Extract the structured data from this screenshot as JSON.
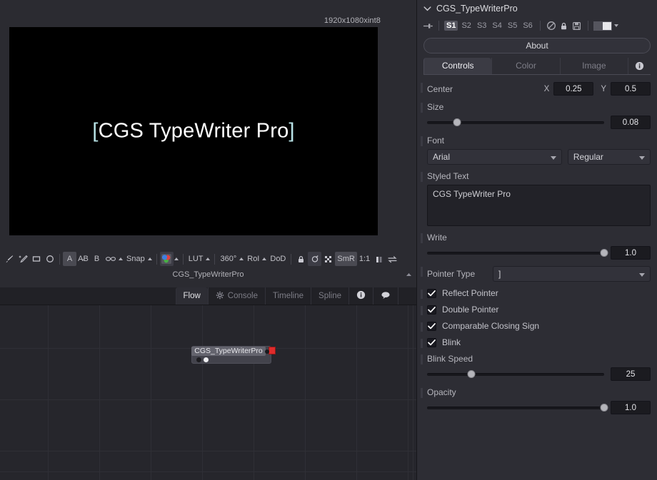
{
  "viewer": {
    "resolution_label": "1920x1080xint8",
    "image_text_open_bracket": "[",
    "image_text": "CGS TypeWriter Pro",
    "image_text_close_bracket": "]",
    "node_name_label": "CGS_TypeWriterPro"
  },
  "viewer_toolbar": {
    "items": [
      {
        "name": "paint-brush-icon",
        "label": ""
      },
      {
        "name": "magic-wand-icon",
        "label": ""
      },
      {
        "name": "rectangle-icon",
        "label": ""
      },
      {
        "name": "ellipse-icon",
        "label": ""
      },
      {
        "name": "buffer-a-button",
        "label": "A"
      },
      {
        "name": "buffer-ab-button",
        "label": "A̵B"
      },
      {
        "name": "buffer-b-button",
        "label": "B"
      },
      {
        "name": "stereo-glasses-icon",
        "label": ""
      },
      {
        "name": "snap-button",
        "label": "Snap"
      },
      {
        "name": "color-channels-swatch",
        "label": ""
      },
      {
        "name": "lut-button",
        "label": "LUT"
      },
      {
        "name": "degrees-360-button",
        "label": "360°"
      },
      {
        "name": "roi-button",
        "label": "RoI"
      },
      {
        "name": "dod-button",
        "label": "DoD"
      },
      {
        "name": "lock-icon",
        "label": ""
      },
      {
        "name": "subview-icon",
        "label": ""
      },
      {
        "name": "checkerboard-icon",
        "label": ""
      },
      {
        "name": "smr-button",
        "label": "SmR"
      },
      {
        "name": "one-to-one-button",
        "label": "1:1"
      },
      {
        "name": "split-view-icon",
        "label": ""
      },
      {
        "name": "swap-icon",
        "label": ""
      }
    ]
  },
  "flow_tabs": [
    {
      "label": "Flow",
      "icon": "",
      "active": true
    },
    {
      "label": "Console",
      "icon": "gear-icon",
      "active": false
    },
    {
      "label": "Timeline",
      "icon": "",
      "active": false
    },
    {
      "label": "Spline",
      "icon": "",
      "active": false
    },
    {
      "label": "",
      "icon": "info-icon",
      "active": false
    },
    {
      "label": "",
      "icon": "chat-icon",
      "active": false
    }
  ],
  "flow": {
    "node_label": "CGS_TypeWriterPro"
  },
  "inspector": {
    "title": "CGS_TypeWriterPro",
    "collapse_icon": "chevron-down-icon",
    "state_buttons": [
      {
        "label": "S1",
        "active": true
      },
      {
        "label": "S2",
        "active": false
      },
      {
        "label": "S3",
        "active": false
      },
      {
        "label": "S4",
        "active": false
      },
      {
        "label": "S5",
        "active": false
      },
      {
        "label": "S6",
        "active": false
      }
    ],
    "about_label": "About",
    "tabs": [
      {
        "label": "Controls",
        "active": true
      },
      {
        "label": "Color",
        "active": false
      },
      {
        "label": "Image",
        "active": false
      },
      {
        "label": "",
        "active": false,
        "icon": "info-icon"
      }
    ]
  },
  "controls": {
    "center": {
      "label": "Center",
      "x_label": "X",
      "x_value": "0.25",
      "y_label": "Y",
      "y_value": "0.5"
    },
    "size": {
      "label": "Size",
      "value": "0.08",
      "percent": 17
    },
    "font": {
      "label": "Font",
      "family": "Arial",
      "style": "Regular"
    },
    "styled_text": {
      "label": "Styled Text",
      "value": "CGS TypeWriter Pro"
    },
    "write": {
      "label": "Write",
      "value": "1.0",
      "percent": 100
    },
    "pointer_type": {
      "label": "Pointer Type",
      "value": "]"
    },
    "checkboxes": [
      {
        "label": "Reflect Pointer",
        "checked": true
      },
      {
        "label": "Double Pointer",
        "checked": true
      },
      {
        "label": "Comparable Closing Sign",
        "checked": true
      },
      {
        "label": "Blink",
        "checked": true
      }
    ],
    "blink_speed": {
      "label": "Blink Speed",
      "value": "25",
      "percent": 25
    },
    "opacity": {
      "label": "Opacity",
      "value": "1.0",
      "percent": 100
    }
  },
  "colors": {
    "panel_bg": "#2d2d34",
    "viewer_bg": "#2b2b31",
    "image_bg": "#000000",
    "accent_text": "#ffffff",
    "bracket_tint": "#b9e4e8",
    "node_flag": "#e02b2b",
    "active_tab": "#3b3b44"
  }
}
